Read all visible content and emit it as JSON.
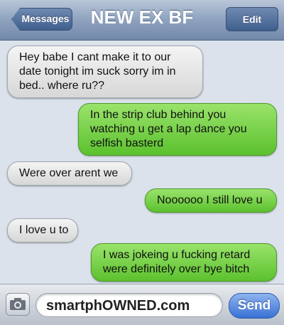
{
  "header": {
    "back_label": "Messages",
    "title": "NEW EX BF",
    "edit_label": "Edit"
  },
  "messages": [
    {
      "from": "them",
      "text": "Hey babe I cant make it to our date tonight im suck sorry im in bed.. where ru??"
    },
    {
      "from": "me",
      "text": "In the strip club behind you watching u get a lap dance you selfish basterd"
    },
    {
      "from": "them",
      "text": "Were over arent we"
    },
    {
      "from": "me",
      "text": "Noooooo I still love u"
    },
    {
      "from": "them",
      "text": "I love u to"
    },
    {
      "from": "me",
      "text": "I was jokeing u fucking retard were definitely over bye bitch"
    }
  ],
  "composer": {
    "field_text": "smartphOWNED.com",
    "send_label": "Send",
    "camera_icon": "camera-icon"
  },
  "colors": {
    "sent_bubble": "#6fd03e",
    "received_bubble": "#e8e8e8",
    "nav_bar": "#8ea2bf",
    "send_button": "#3870d4"
  }
}
